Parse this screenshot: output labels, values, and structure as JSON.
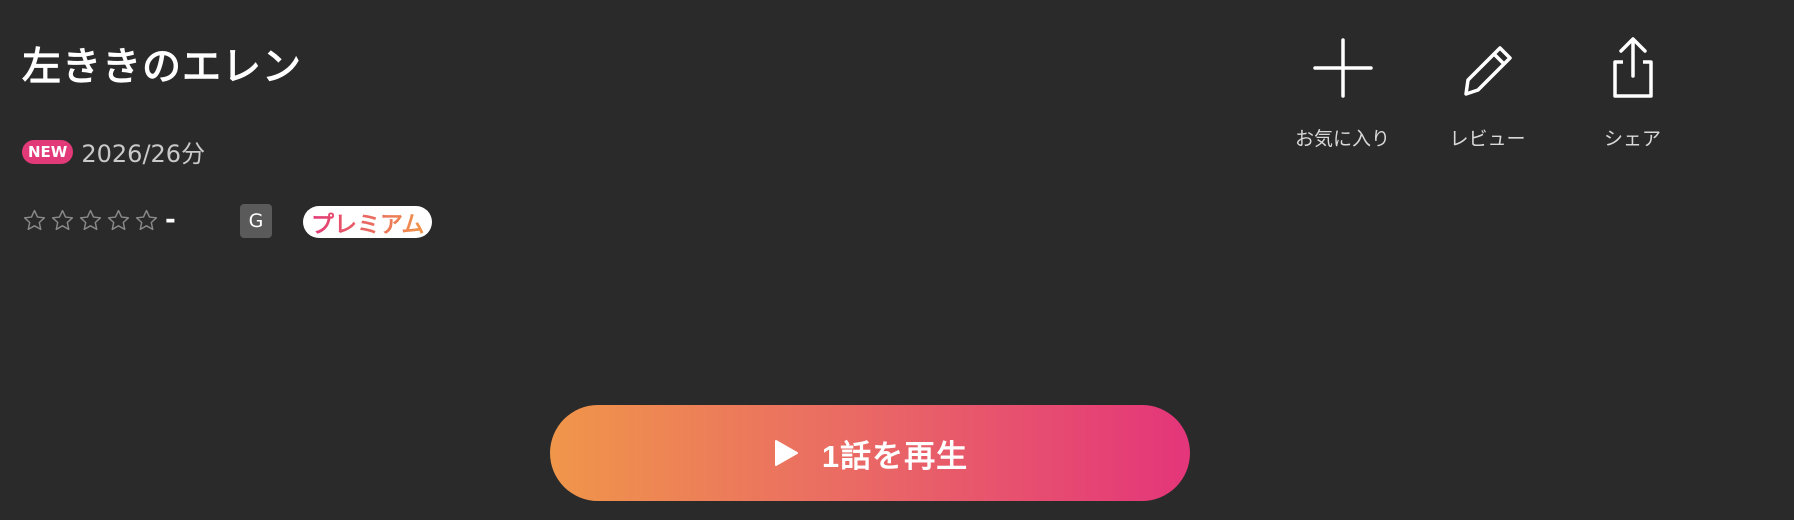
{
  "title": "左ききのエレン",
  "meta": {
    "new_badge": "NEW",
    "year_duration": "2026/26分"
  },
  "rating": {
    "stars_total": 5,
    "stars_filled": 0,
    "value": "-"
  },
  "age_rating": "G",
  "premium_label": "プレミアム",
  "actions": [
    {
      "label": "お気に入り",
      "icon": "plus-icon"
    },
    {
      "label": "レビュー",
      "icon": "pencil-icon"
    },
    {
      "label": "シェア",
      "icon": "share-icon"
    }
  ],
  "play_button": {
    "label": "1話を再生",
    "icon": "play-icon"
  },
  "colors": {
    "background": "#2a2a2a",
    "new_badge": "#e23a78",
    "gradient_start": "#f0964a",
    "gradient_end": "#e4357a"
  }
}
